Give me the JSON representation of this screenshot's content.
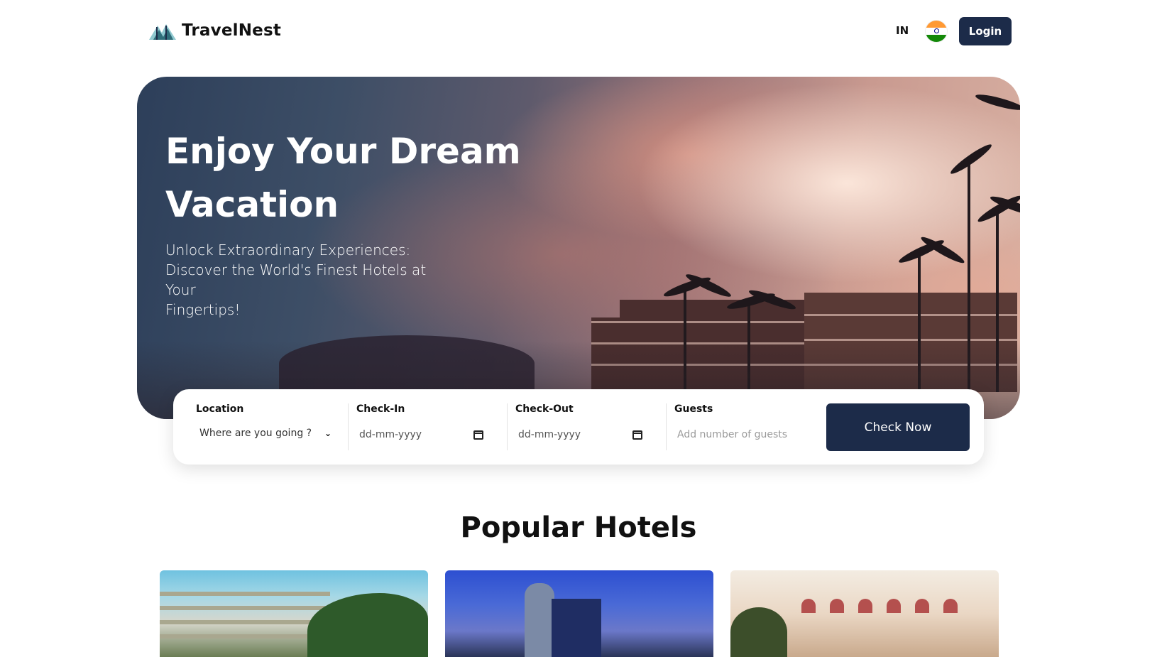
{
  "header": {
    "brand_name": "TravelNest",
    "locale_code": "IN",
    "login_label": "Login",
    "colors": {
      "primary": "#1c2b49"
    }
  },
  "hero": {
    "title_line1": "Enjoy Your Dream",
    "title_line2": "Vacation",
    "subtitle_line1": "Unlock Extraordinary Experiences:",
    "subtitle_line2": "Discover the World's Finest Hotels at Your",
    "subtitle_line3": "Fingertips!"
  },
  "search": {
    "location": {
      "label": "Location",
      "value": "Where are you going ?"
    },
    "check_in": {
      "label": "Check-In",
      "placeholder": "dd-mm-yyyy"
    },
    "check_out": {
      "label": "Check-Out",
      "placeholder": "dd-mm-yyyy"
    },
    "guests": {
      "label": "Guests",
      "placeholder": "Add number of guests"
    },
    "submit_label": "Check Now"
  },
  "popular": {
    "title": "Popular Hotels"
  }
}
